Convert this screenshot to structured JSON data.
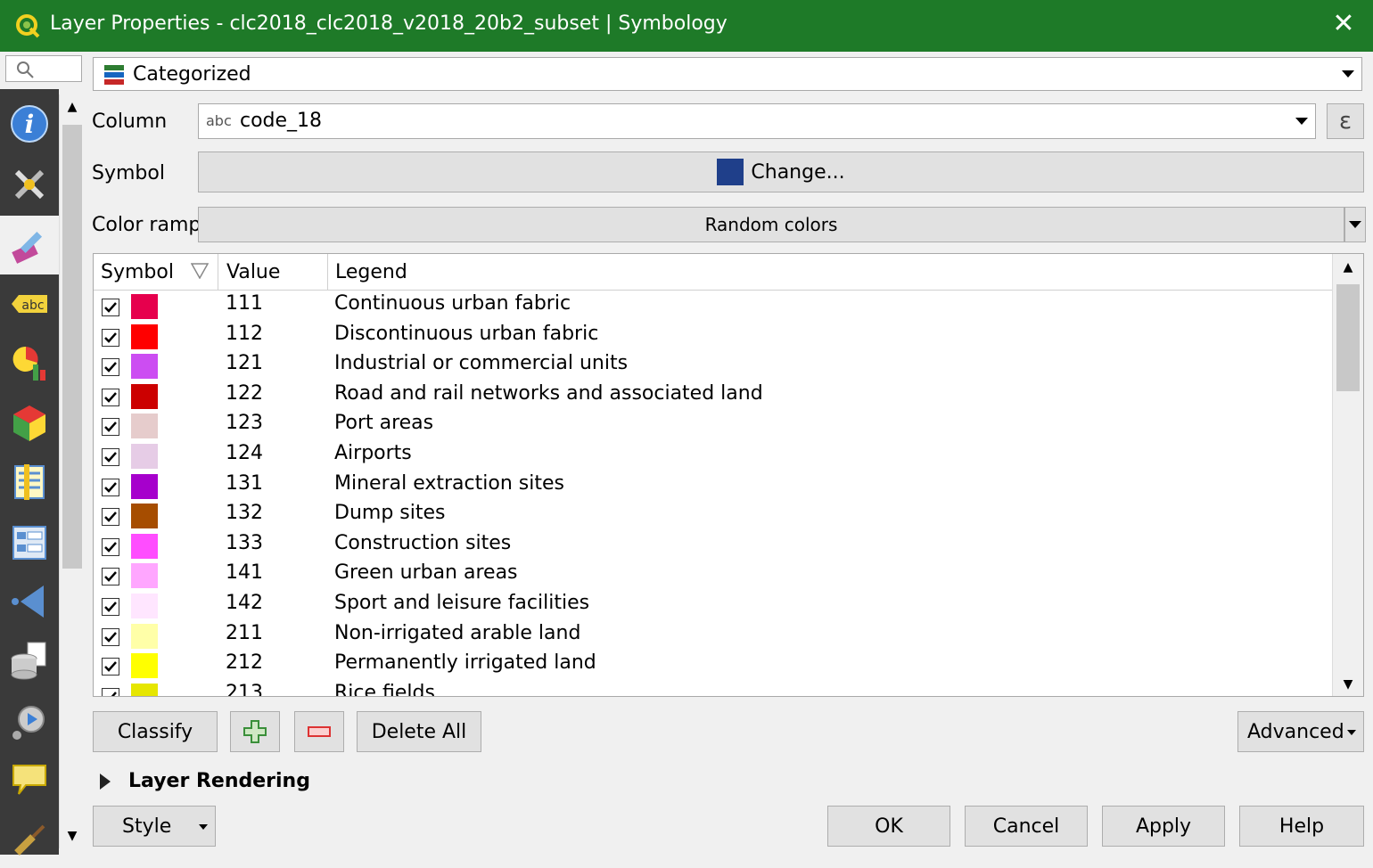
{
  "window": {
    "title": "Layer Properties - clc2018_clc2018_v2018_20b2_subset | Symbology"
  },
  "renderer": {
    "type_label": "Categorized"
  },
  "column": {
    "label": "Column",
    "type_badge": "abc",
    "value": "code_18"
  },
  "symbol": {
    "label": "Symbol",
    "button_label": "Change...",
    "color": "#1f3f8a"
  },
  "color_ramp": {
    "label": "Color ramp",
    "value": "Random colors"
  },
  "table": {
    "headers": {
      "symbol": "Symbol",
      "value": "Value",
      "legend": "Legend"
    },
    "rows": [
      {
        "value": "111",
        "legend": "Continuous urban fabric",
        "color": "#e6004d"
      },
      {
        "value": "112",
        "legend": "Discontinuous urban fabric",
        "color": "#ff0000"
      },
      {
        "value": "121",
        "legend": "Industrial or commercial units",
        "color": "#cc4df2"
      },
      {
        "value": "122",
        "legend": "Road and rail networks and associated land",
        "color": "#cc0000"
      },
      {
        "value": "123",
        "legend": "Port areas",
        "color": "#e6cccc"
      },
      {
        "value": "124",
        "legend": "Airports",
        "color": "#e6cce6"
      },
      {
        "value": "131",
        "legend": "Mineral extraction sites",
        "color": "#a600cc"
      },
      {
        "value": "132",
        "legend": "Dump sites",
        "color": "#a64d00"
      },
      {
        "value": "133",
        "legend": "Construction sites",
        "color": "#ff4dff"
      },
      {
        "value": "141",
        "legend": "Green urban areas",
        "color": "#ffa6ff"
      },
      {
        "value": "142",
        "legend": "Sport and leisure facilities",
        "color": "#ffe6ff"
      },
      {
        "value": "211",
        "legend": "Non-irrigated arable land",
        "color": "#ffffa8"
      },
      {
        "value": "212",
        "legend": "Permanently irrigated land",
        "color": "#ffff00"
      },
      {
        "value": "213",
        "legend": "Rice fields",
        "color": "#e6e600"
      }
    ]
  },
  "buttons": {
    "classify": "Classify",
    "delete_all": "Delete All",
    "advanced": "Advanced",
    "style": "Style",
    "ok": "OK",
    "cancel": "Cancel",
    "apply": "Apply",
    "help": "Help"
  },
  "layer_rendering": {
    "label": "Layer Rendering"
  },
  "sidebar": {
    "icons": [
      "information-icon",
      "source-tools-icon",
      "symbology-brush-icon",
      "labels-abc-icon",
      "diagrams-icon",
      "3d-view-icon",
      "fields-icon",
      "attributes-form-icon",
      "joins-icon",
      "auxiliary-storage-icon",
      "actions-icon",
      "display-tips-icon",
      "rendering-brush-icon"
    ]
  },
  "colors": {
    "titlebar": "#1e7a28",
    "sidebar": "#3a3a3a"
  }
}
